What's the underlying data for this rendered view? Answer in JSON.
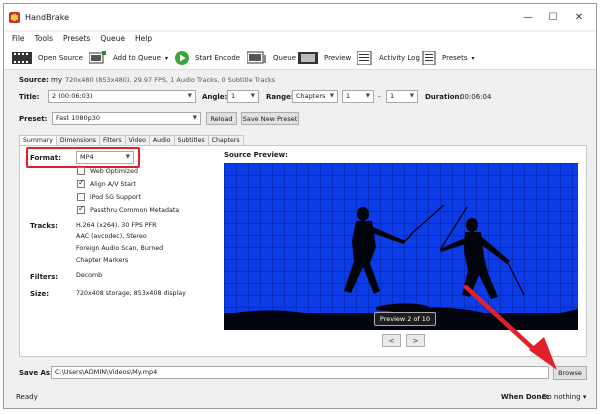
{
  "window": {
    "title": "HandBrake",
    "minimize": "—",
    "maximize": "☐",
    "close": "✕"
  },
  "menu": [
    "File",
    "Tools",
    "Presets",
    "Queue",
    "Help"
  ],
  "toolbar": {
    "open_source": "Open Source",
    "add_to_queue": "Add to Queue",
    "start_encode": "Start Encode",
    "queue": "Queue",
    "preview": "Preview",
    "activity_log": "Activity Log",
    "presets": "Presets"
  },
  "source": {
    "label": "Source:",
    "name": "my",
    "info": "720x480 (853x480), 29.97 FPS, 1 Audio Tracks, 0 Subtitle Tracks"
  },
  "title_row": {
    "title_label": "Title:",
    "title_value": "2 (00:06:03)",
    "angle_label": "Angle:",
    "angle_value": "1",
    "range_label": "Range:",
    "range_value": "Chapters",
    "range_from": "1",
    "range_sep": "-",
    "range_to": "1",
    "duration_label": "Duration:",
    "duration_value": "00:06:04"
  },
  "preset_row": {
    "label": "Preset:",
    "value": "Fast 1080p30",
    "reload": "Reload",
    "save_new": "Save New Preset"
  },
  "tabs": [
    "Summary",
    "Dimensions",
    "Filters",
    "Video",
    "Audio",
    "Subtitles",
    "Chapters"
  ],
  "summary": {
    "format_label": "Format:",
    "format_value": "MP4",
    "options": [
      {
        "label": "Web Optimized",
        "checked": false
      },
      {
        "label": "Align A/V Start",
        "checked": true
      },
      {
        "label": "iPod 5G Support",
        "checked": false
      },
      {
        "label": "Passthru Common Metadata",
        "checked": true
      }
    ],
    "tracks_label": "Tracks:",
    "tracks": [
      "H.264 (x264), 30 FPS PFR",
      "AAC (avcodec), Stereo",
      "Foreign Audio Scan, Burned",
      "Chapter Markers"
    ],
    "filters_label": "Filters:",
    "filters_value": "Decomb",
    "size_label": "Size:",
    "size_value": "720x408 storage, 853x408 display"
  },
  "source_preview": {
    "label": "Source Preview:",
    "caption": "Preview 2 of 10",
    "prev": "<",
    "next": ">"
  },
  "save_as": {
    "label": "Save As:",
    "value": "C:\\Users\\ADMIN\\Videos\\My.mp4",
    "browse": "Browse"
  },
  "status": {
    "text": "Ready",
    "when_done_label": "When Done:",
    "when_done_value": "Do nothing"
  },
  "colors": {
    "highlight": "#e0202a",
    "preview_bg": "#0b3ce8",
    "start_green": "#3aa53a"
  }
}
